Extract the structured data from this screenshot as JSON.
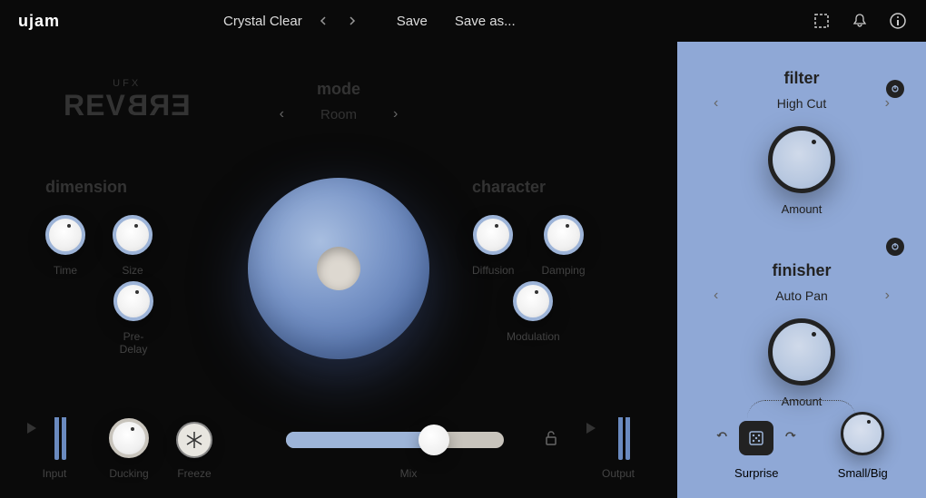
{
  "header": {
    "logo": "ujam",
    "preset_name": "Crystal Clear",
    "save_label": "Save",
    "save_as_label": "Save as..."
  },
  "brand": {
    "sub": "UFX",
    "main": "REVERB"
  },
  "mode": {
    "title": "mode",
    "value": "Room"
  },
  "dimension": {
    "title": "dimension",
    "time": "Time",
    "size": "Size",
    "predelay": "Pre-Delay"
  },
  "character": {
    "title": "character",
    "diffusion": "Diffusion",
    "damping": "Damping",
    "modulation": "Modulation"
  },
  "bottom": {
    "input": "Input",
    "ducking": "Ducking",
    "freeze": "Freeze",
    "mix": "Mix",
    "output": "Output"
  },
  "filter": {
    "title": "filter",
    "value": "High Cut",
    "amount": "Amount"
  },
  "finisher": {
    "title": "finisher",
    "value": "Auto Pan",
    "amount": "Amount"
  },
  "surprise": {
    "label": "Surprise",
    "smallbig": "Small/Big"
  }
}
